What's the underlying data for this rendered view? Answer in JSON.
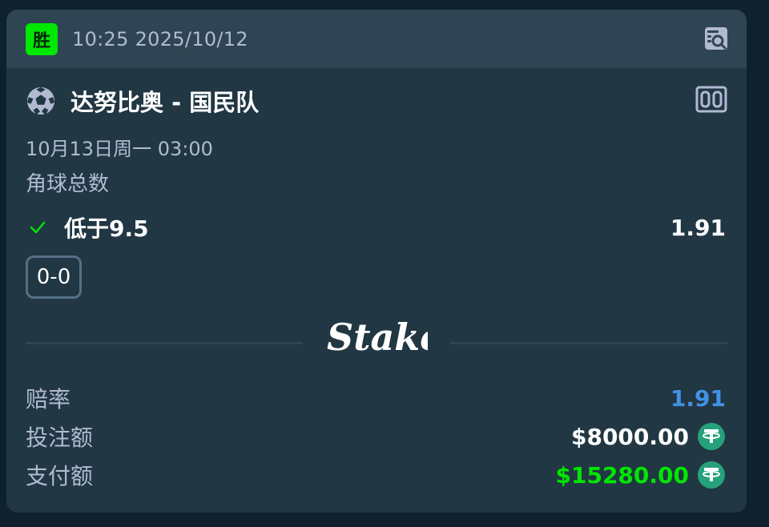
{
  "header": {
    "badge": "胜",
    "datetime": "10:25 2025/10/12",
    "icons": {
      "search": "receipt-search-icon"
    }
  },
  "match": {
    "sport_icon": "soccer-ball-icon",
    "title": "达努比奥 - 国民队",
    "scoreboard_icon": "scoreboard-icon",
    "date": "10月13日周一  03:00",
    "market": "角球总数"
  },
  "selection": {
    "status_icon": "check-icon",
    "label": "低于9.5",
    "odds": "1.91",
    "score": "0-0"
  },
  "brand": {
    "logo_text": "Stake"
  },
  "summary": {
    "odds_label": "赔率",
    "odds_value": "1.91",
    "stake_label": "投注额",
    "stake_value": "$8000.00",
    "payout_label": "支付额",
    "payout_value": "$15280.00",
    "currency_icon": "usdt-tether-icon"
  },
  "colors": {
    "background": "#0f212e",
    "card": "#213743",
    "header": "#2f4553",
    "win_green": "#00e701",
    "odds_blue": "#4391e7",
    "muted_text": "#b1bad3",
    "tether_green": "#26a17b"
  }
}
